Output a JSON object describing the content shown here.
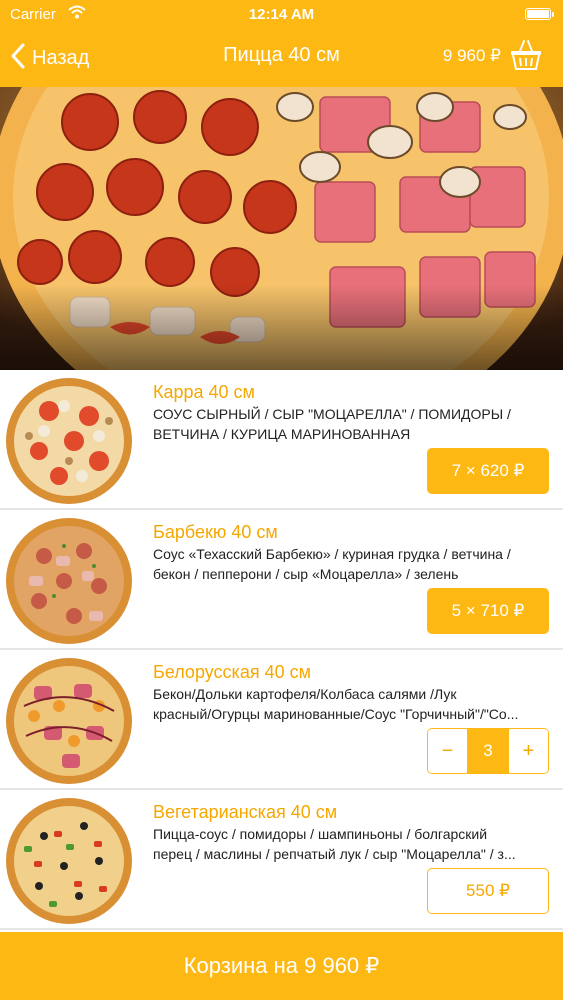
{
  "status_bar": {
    "carrier": "Carrier",
    "time": "12:14 AM"
  },
  "nav": {
    "back_label": "Назад",
    "title": "Пицца 40 см",
    "cart_total": "9 960 ₽",
    "icons": {
      "back": "chevron-left-icon",
      "basket": "basket-icon"
    }
  },
  "colors": {
    "accent": "#fdb813",
    "accent_text": "#f6a700",
    "divider": "#e6e6e6"
  },
  "products": [
    {
      "name": "Карра 40 см",
      "desc_lines": [
        "СОУС СЫРНЫЙ / СЫР \"МОЦАРЕЛЛА\" / ПОМИДОРЫ /",
        "ВЕТЧИНА / КУРИЦА МАРИНОВАННАЯ"
      ],
      "price_label": "7 × 620 ₽"
    },
    {
      "name": "Барбекю 40 см",
      "desc_lines": [
        "Соус «Техасский Барбекю» / куриная грудка / ветчина /",
        "бекон / пепперони / сыр «Моцарелла» / зелень"
      ],
      "price_label": "5 × 710 ₽"
    },
    {
      "name": "Белорусская 40 см",
      "desc_lines": [
        "Бекон/Дольки картофеля/Колбаса салями /Лук",
        "красный/Огурцы маринованные/Соус \"Горчичный\"/\"Со..."
      ],
      "stepper": {
        "minus": "−",
        "qty": "3",
        "plus": "+"
      }
    },
    {
      "name": "Вегетарианская 40 см",
      "desc_lines": [
        "Пицца-соус / помидоры / шампиньоны / болгарский",
        "перец / маслины / репчатый лук / сыр \"Моцарелла\" / з..."
      ],
      "price_label": "550 ₽"
    }
  ],
  "footer": {
    "cart_button_label": "Корзина на 9 960 ₽"
  }
}
